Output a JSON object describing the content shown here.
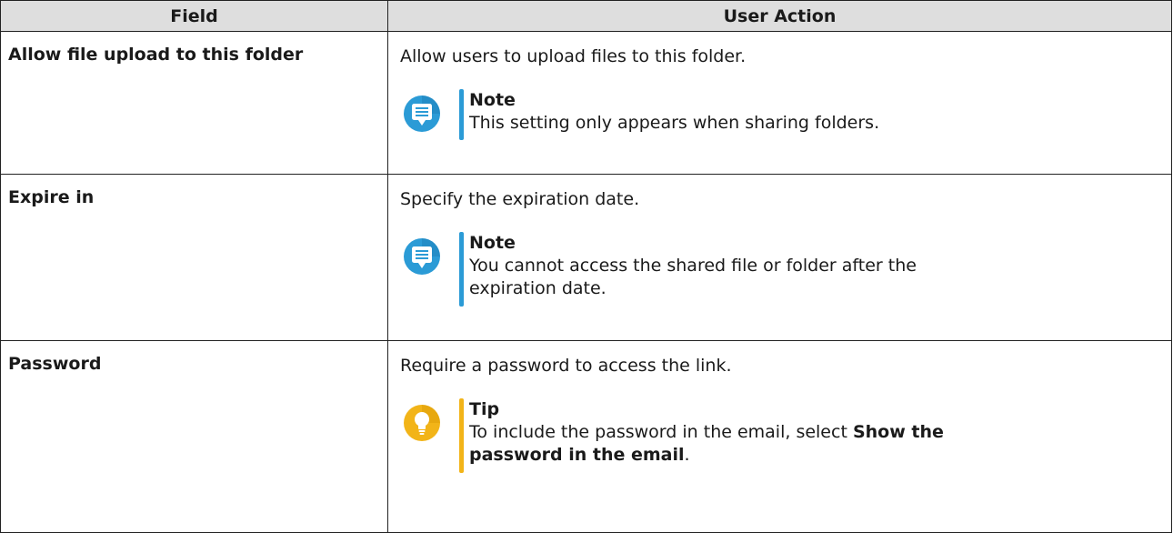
{
  "table": {
    "headers": {
      "field": "Field",
      "action": "User Action"
    },
    "rows": [
      {
        "field": "Allow file upload to this folder",
        "action": "Allow users to upload files to this folder.",
        "callout": {
          "type": "note",
          "icon": "note-icon",
          "title": "Note",
          "text": "This setting only appears when sharing folders."
        }
      },
      {
        "field": "Expire in",
        "action": "Specify the expiration date.",
        "callout": {
          "type": "note",
          "icon": "note-icon",
          "title": "Note",
          "text": "You cannot access the shared file or folder after the expiration date."
        }
      },
      {
        "field": "Password",
        "action": "Require a password to access the link.",
        "callout": {
          "type": "tip",
          "icon": "lightbulb-icon",
          "title": "Tip",
          "text_before": "To include the password in the email, select ",
          "text_bold": "Show the password in the email",
          "text_after": "."
        }
      }
    ]
  },
  "colors": {
    "header_bg": "#dedede",
    "note_accent": "#2b9bd6",
    "tip_accent": "#f2b418",
    "border": "#222222"
  }
}
